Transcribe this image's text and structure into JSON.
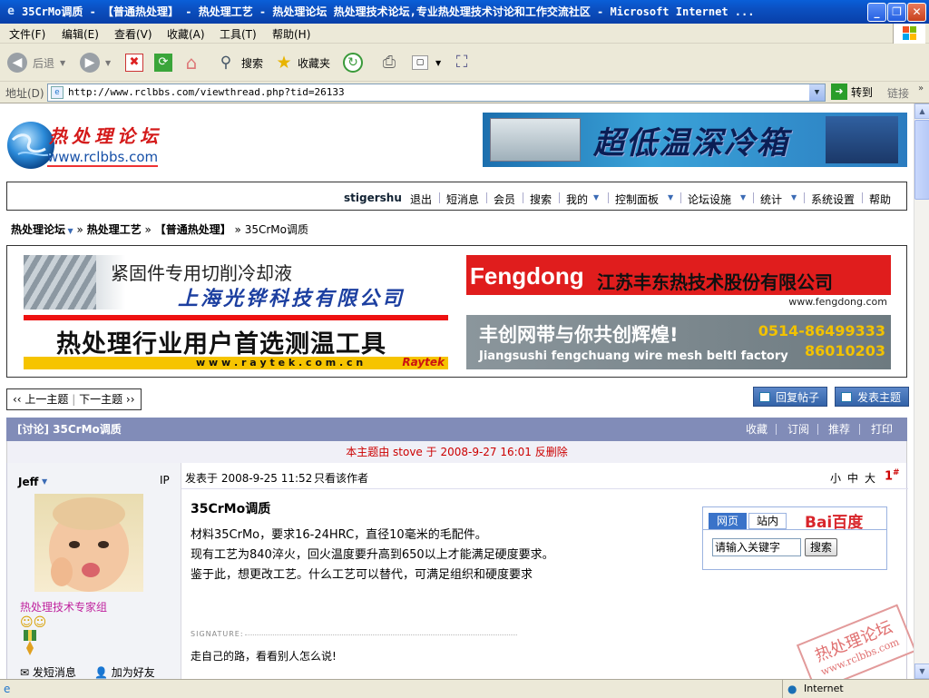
{
  "window": {
    "title": "35CrMo调质 - 【普通热处理】 - 热处理工艺 - 热处理论坛 热处理技术论坛,专业热处理技术讨论和工作交流社区 - Microsoft Internet ..."
  },
  "menu": {
    "items": [
      "文件(F)",
      "编辑(E)",
      "查看(V)",
      "收藏(A)",
      "工具(T)",
      "帮助(H)"
    ]
  },
  "toolbar": {
    "back": "后退",
    "search": "搜索",
    "favorites": "收藏夹"
  },
  "address": {
    "label": "地址(D)",
    "url": "http://www.rclbbs.com/viewthread.php?tid=26133",
    "go": "转到",
    "links": "链接"
  },
  "forum": {
    "logo_title": "热处理论坛",
    "logo_url": "www.rclbbs.com",
    "banner_top": "超低温深冷箱",
    "nav": {
      "username": "stigershu",
      "items": [
        "退出",
        "短消息",
        "会员",
        "搜索",
        "我的",
        "控制面板",
        "论坛设施",
        "统计",
        "系统设置",
        "帮助"
      ]
    },
    "breadcrumb": {
      "home": "热处理论坛",
      "section": "热处理工艺",
      "subsection": "【普通热处理】",
      "current": "35CrMo调质"
    },
    "ads": {
      "ad1_line1": "紧固件专用切削冷却液",
      "ad1_line2": "上海光铧科技有限公司",
      "ad2_brand": "Fengdong",
      "ad2_company": "江苏丰东热技术股份有限公司",
      "ad2_url": "www.fengdong.com",
      "ad3_text": "热处理行业用户首选测温工具",
      "ad3_url": "w w w . r a y t e k . c o m . c n",
      "ad3_brand": "Raytek",
      "ad4_line1": "丰创网带与你共创辉煌!",
      "ad4_line2": "Jiangsushi fengchuang wire mesh beltl factory",
      "ad4_phone1": "0514-86499333",
      "ad4_phone2": "86010203"
    },
    "pager": {
      "prev": "‹‹ 上一主题",
      "next": "下一主题 ››"
    },
    "buttons": {
      "reply": "回复帖子",
      "new_topic": "发表主题"
    },
    "thread": {
      "title": "[讨论] 35CrMo调质",
      "actions": [
        "收藏",
        "订阅",
        "推荐",
        "打印"
      ],
      "notice": "本主题由 stove 于 2008-9-27 16:01 反删除"
    },
    "post": {
      "author": "Jeff",
      "ip_label": "IP",
      "group": "热处理技术专家组",
      "send_msg": "发短消息",
      "add_friend": "加为好友",
      "posted_at": "发表于 2008-9-25 11:52",
      "only_author": "只看该作者",
      "font_small": "小",
      "font_medium": "中",
      "font_large": "大",
      "floor": "1",
      "floor_mark": "#",
      "subject": "35CrMo调质",
      "body": [
        "材料35CrMo，要求16-24HRC，直径10毫米的毛配件。",
        "现有工艺为840淬火，回火温度要升高到650以上才能满足硬度要求。",
        "鉴于此，想更改工艺。什么工艺可以替代，可满足组织和硬度要求"
      ],
      "signature_label": "SIGNATURE:",
      "signature": "走自己的路，看看别人怎么说!"
    },
    "baidu": {
      "tab_web": "网页",
      "tab_site": "站内",
      "logo": "Bai百度",
      "input_value": "请输入关键字",
      "search_button": "搜索"
    },
    "watermark": {
      "line1": "热处理论坛",
      "line2": "www.rclbbs.com"
    }
  },
  "status": {
    "zone": "Internet"
  }
}
